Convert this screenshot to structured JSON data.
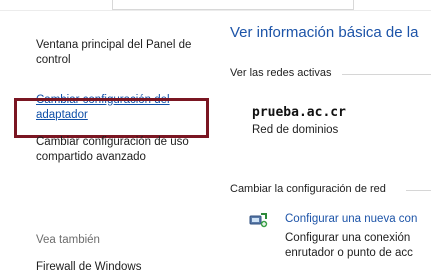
{
  "sidebar": {
    "home_link": "Ventana principal del Panel de control",
    "adapter_link": "Cambiar configuración del adaptador",
    "sharing_link": "Cambiar configuración de uso compartido avanzado",
    "see_also_label": "Vea también",
    "firewall_link": "Firewall de Windows"
  },
  "main": {
    "heading": "Ver información básica de la",
    "active_networks_label": "Ver las redes activas",
    "network": {
      "name": "prueba.ac.cr",
      "type": "Red de dominios"
    },
    "change_settings_label": "Cambiar la configuración de red",
    "task": {
      "icon": "network-setup-icon",
      "link": "Configurar una nueva con",
      "description_line1": "Configurar una conexión",
      "description_line2": "enrutador o punto de acc"
    }
  },
  "colors": {
    "link_blue": "#1d54a8",
    "highlight_border": "#7a1622",
    "muted_text": "#6d6d6d"
  }
}
